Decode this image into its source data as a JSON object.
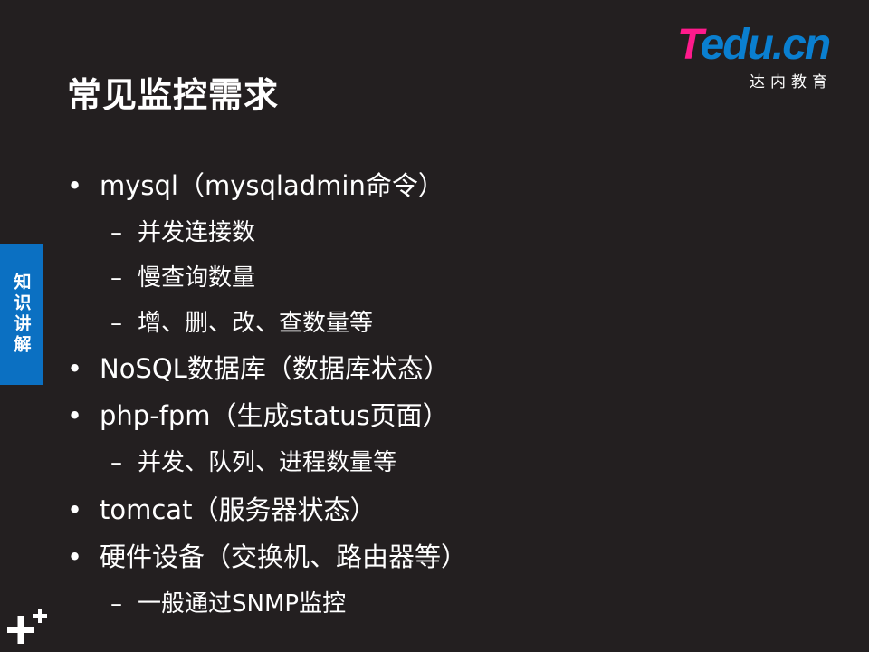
{
  "title": "常见监控需求",
  "logo": {
    "brand_t": "T",
    "brand_rest": "edu.cn",
    "subtitle": "达内教育"
  },
  "side_tab": {
    "label": "知识讲解"
  },
  "bullet_symbol": "•",
  "dash_symbol": "–",
  "items": [
    {
      "level": 1,
      "text": "mysql（mysqladmin命令）"
    },
    {
      "level": 2,
      "text": "并发连接数"
    },
    {
      "level": 2,
      "text": "慢查询数量"
    },
    {
      "level": 2,
      "text": "增、删、改、查数量等"
    },
    {
      "level": 1,
      "text": "NoSQL数据库（数据库状态）"
    },
    {
      "level": 1,
      "text": "php-fpm（生成status页面）"
    },
    {
      "level": 2,
      "text": "并发、队列、进程数量等"
    },
    {
      "level": 1,
      "text": "tomcat（服务器状态）"
    },
    {
      "level": 1,
      "text": "硬件设备（交换机、路由器等）"
    },
    {
      "level": 2,
      "text": "一般通过SNMP监控"
    }
  ],
  "colors": {
    "background": "#231f20",
    "tab": "#0b70c2",
    "brand_blue": "#0a7fd0",
    "brand_pink": "#ff1a8c"
  }
}
